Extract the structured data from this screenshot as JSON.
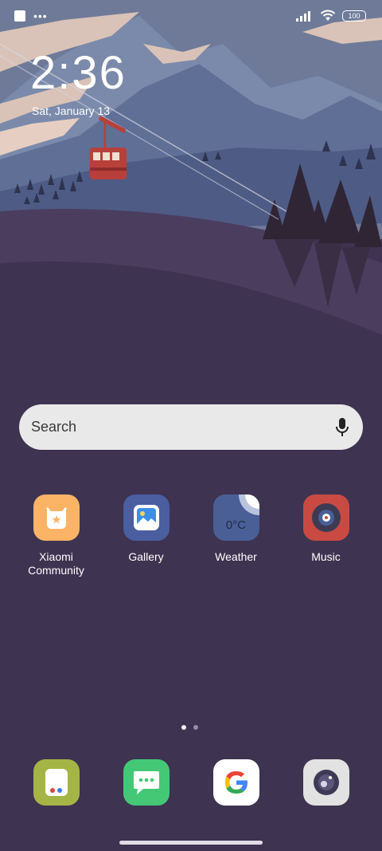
{
  "status_bar": {
    "battery": "100"
  },
  "lock": {
    "time": "2:36",
    "date": "Sat, January 13"
  },
  "search": {
    "placeholder": "Search"
  },
  "apps": [
    {
      "label": "Xiaomi Community",
      "icon": "xiaomi-community-icon",
      "color": "#fbb366"
    },
    {
      "label": "Gallery",
      "icon": "gallery-icon",
      "color": "#4a5ea0"
    },
    {
      "label": "Weather",
      "icon": "weather-icon",
      "color": "#4a5f96",
      "temp": "0°C"
    },
    {
      "label": "Music",
      "icon": "music-icon",
      "color": "#c84a42"
    }
  ],
  "dock": [
    {
      "icon": "launcher-icon",
      "color": "#a4b545"
    },
    {
      "icon": "messages-icon",
      "color": "#44c876"
    },
    {
      "icon": "google-icon",
      "color": "#ffffff"
    },
    {
      "icon": "camera-icon",
      "color": "#e2e2e2"
    }
  ],
  "pager": {
    "current": 1,
    "total": 2
  }
}
